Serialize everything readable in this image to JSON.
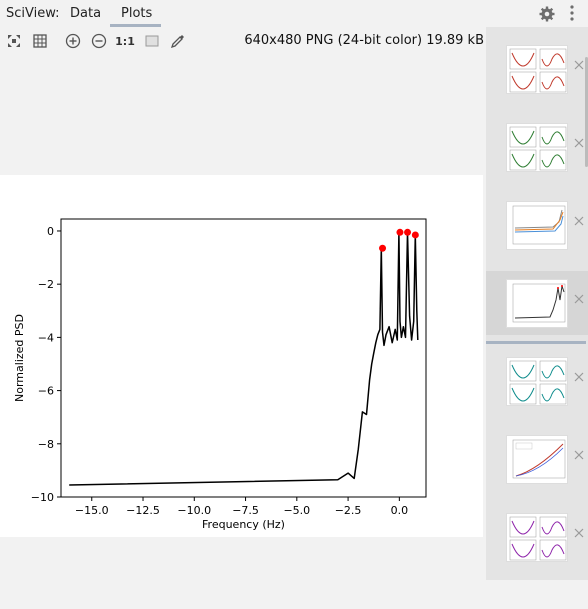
{
  "app": {
    "title": "SciView:"
  },
  "tabs": [
    {
      "label": "Data"
    },
    {
      "label": "Plots"
    }
  ],
  "toolbar": {
    "actual_size_label": "1:1",
    "image_info": "640x480 PNG (24-bit color) 19.89 kB"
  },
  "chart_data": {
    "type": "line",
    "title": "",
    "xlabel": "Frequency (Hz)",
    "ylabel": "Normalized PSD",
    "xlim": [
      -16.5,
      1.3
    ],
    "ylim": [
      -10,
      0.45
    ],
    "x_ticks": [
      -15.0,
      -12.5,
      -10.0,
      -7.5,
      -5.0,
      -2.5,
      0.0
    ],
    "x_tick_labels": [
      "−15.0",
      "−12.5",
      "−10.0",
      "−7.5",
      "−5.0",
      "−2.5",
      "0.0"
    ],
    "y_ticks": [
      0,
      -2,
      -4,
      -6,
      -8,
      -10
    ],
    "y_tick_labels": [
      "0",
      "−2",
      "−4",
      "−6",
      "−8",
      "−10"
    ],
    "grid": false,
    "series": [
      {
        "color": "#000000",
        "x": [
          -16.1,
          -3.0,
          -2.5,
          -2.2,
          -2.0,
          -1.8,
          -1.6,
          -1.45,
          -1.35,
          -1.25,
          -1.15,
          -1.05,
          -0.95,
          -0.88,
          -0.82,
          -0.75,
          -0.65,
          -0.5,
          -0.35,
          -0.2,
          -0.1,
          -0.02,
          0.03,
          0.1,
          0.2,
          0.3,
          0.4,
          0.5,
          0.6,
          0.7,
          0.78,
          0.85,
          0.9
        ],
        "y": [
          -9.55,
          -9.35,
          -9.1,
          -9.3,
          -8.2,
          -6.8,
          -6.9,
          -5.6,
          -5.0,
          -4.6,
          -4.2,
          -3.9,
          -3.7,
          -0.65,
          -3.8,
          -4.3,
          -3.9,
          -3.6,
          -4.2,
          -3.7,
          -4.1,
          -0.05,
          -3.4,
          -4.0,
          -3.6,
          -4.0,
          -0.05,
          -3.2,
          -4.1,
          -3.4,
          -0.15,
          -3.0,
          -4.1
        ]
      }
    ],
    "markers": {
      "color": "#ff0000",
      "x": [
        -0.82,
        0.03,
        0.4,
        0.78
      ],
      "y": [
        -0.65,
        -0.05,
        -0.05,
        -0.15
      ]
    }
  },
  "thumbnails": [
    {
      "kind": "grid-curves",
      "color": "#c0392b"
    },
    {
      "kind": "grid-curves",
      "color": "#2e7d32"
    },
    {
      "kind": "multi-line",
      "color": "#e67e22"
    },
    {
      "kind": "psd-line",
      "color": "#333333"
    },
    {
      "kind": "grid-curves",
      "color": "#0e8c8c"
    },
    {
      "kind": "rising-line",
      "color": "#c0392b"
    },
    {
      "kind": "grid-curves",
      "color": "#8e24aa"
    }
  ]
}
